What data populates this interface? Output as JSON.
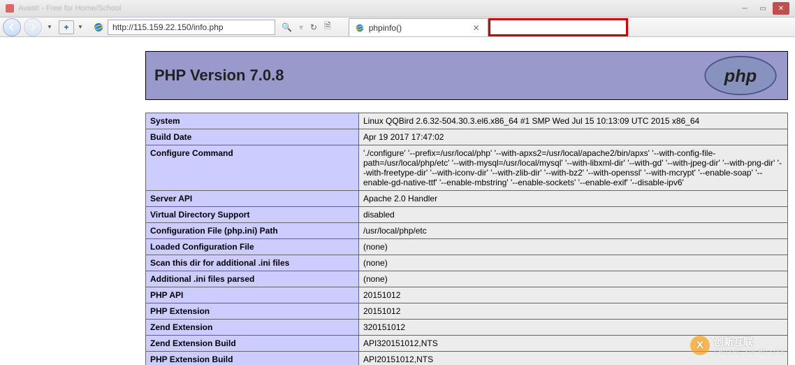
{
  "browser": {
    "title_blurred": "Avast! - Free for Home/School",
    "url": "http://115.159.22.150/info.php",
    "search_placeholder": "",
    "tabs": [
      {
        "title": "phpinfo()"
      }
    ]
  },
  "page": {
    "header_title": "PHP Version 7.0.8",
    "rows": [
      {
        "key": "System",
        "value": "Linux QQBird 2.6.32-504.30.3.el6.x86_64 #1 SMP Wed Jul 15 10:13:09 UTC 2015 x86_64"
      },
      {
        "key": "Build Date",
        "value": "Apr 19 2017 17:47:02"
      },
      {
        "key": "Configure Command",
        "value": "'./configure' '--prefix=/usr/local/php' '--with-apxs2=/usr/local/apache2/bin/apxs' '--with-config-file-path=/usr/local/php/etc' '--with-mysql=/usr/local/mysql' '--with-libxml-dir' '--with-gd' '--with-jpeg-dir' '--with-png-dir' '--with-freetype-dir' '--with-iconv-dir' '--with-zlib-dir' '--with-bz2' '--with-openssl' '--with-mcrypt' '--enable-soap' '--enable-gd-native-ttf' '--enable-mbstring' '--enable-sockets' '--enable-exif' '--disable-ipv6'"
      },
      {
        "key": "Server API",
        "value": "Apache 2.0 Handler"
      },
      {
        "key": "Virtual Directory Support",
        "value": "disabled"
      },
      {
        "key": "Configuration File (php.ini) Path",
        "value": "/usr/local/php/etc"
      },
      {
        "key": "Loaded Configuration File",
        "value": "(none)"
      },
      {
        "key": "Scan this dir for additional .ini files",
        "value": "(none)"
      },
      {
        "key": "Additional .ini files parsed",
        "value": "(none)"
      },
      {
        "key": "PHP API",
        "value": "20151012"
      },
      {
        "key": "PHP Extension",
        "value": "20151012"
      },
      {
        "key": "Zend Extension",
        "value": "320151012"
      },
      {
        "key": "Zend Extension Build",
        "value": "API320151012,NTS"
      },
      {
        "key": "PHP Extension Build",
        "value": "API20151012,NTS"
      }
    ]
  },
  "watermark": {
    "brand": "创新互联",
    "sub": "CHUANG XIN HU LIAN"
  }
}
